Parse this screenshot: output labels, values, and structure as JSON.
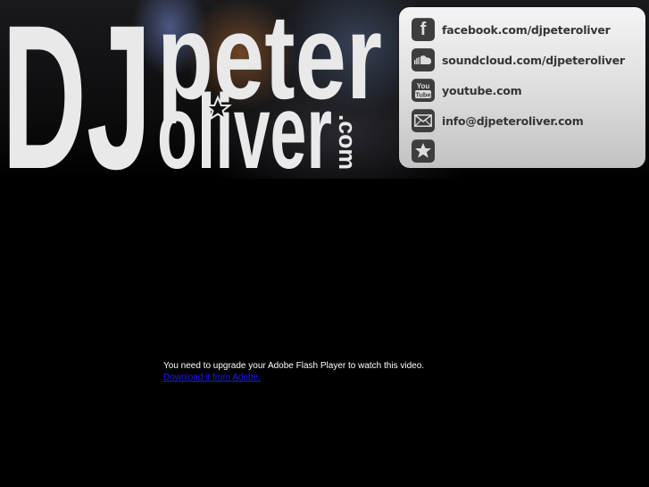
{
  "logo": {
    "dj": "DJ",
    "first": "peter",
    "last": "oliver",
    "domain": ".com"
  },
  "links": [
    {
      "icon": "facebook-icon",
      "glyph": "f",
      "label": "facebook.com/djpeteroliver"
    },
    {
      "icon": "soundcloud-icon",
      "glyph": "",
      "label": "soundcloud.com/djpeteroliver"
    },
    {
      "icon": "youtube-icon",
      "glyph": "You Tube",
      "label": "youtube.com"
    },
    {
      "icon": "email-icon",
      "glyph": "",
      "label": "info@djpeteroliver.com"
    },
    {
      "icon": "star-icon",
      "glyph": "",
      "label": ""
    }
  ],
  "flash": {
    "message": "You need to upgrade your Adobe Flash Player to watch this video.",
    "link_text": "Download it from Adobe."
  },
  "colors": {
    "background": "#000000",
    "panel": "#dcdcdc",
    "icon_bg": "#3d3d3d",
    "link_text": "#353535",
    "flash_link": "#1a1aff"
  }
}
